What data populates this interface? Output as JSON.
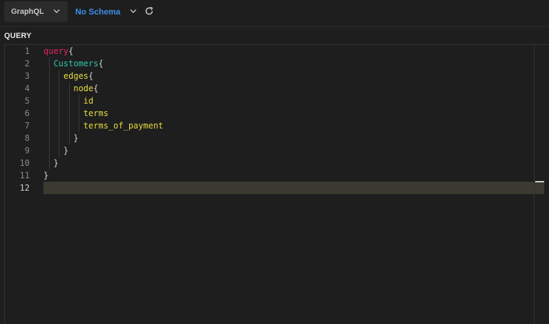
{
  "toolbar": {
    "language": "GraphQL",
    "schema": "No Schema",
    "refresh_icon": "refresh-icon",
    "chevron_icon": "chevron-down-icon"
  },
  "editor": {
    "section_label": "QUERY",
    "active_line": 12,
    "line_numbers": [
      "1",
      "2",
      "3",
      "4",
      "5",
      "6",
      "7",
      "8",
      "9",
      "10",
      "11",
      "12"
    ],
    "lines": [
      {
        "tokens": [
          {
            "text": "query",
            "cls": "kw"
          },
          {
            "text": "{",
            "cls": "brace"
          }
        ]
      },
      {
        "tokens": [
          {
            "text": "  "
          },
          {
            "text": "Customers",
            "cls": "type"
          },
          {
            "text": "{",
            "cls": "brace"
          }
        ]
      },
      {
        "tokens": [
          {
            "text": "    "
          },
          {
            "text": "edges",
            "cls": "field"
          },
          {
            "text": "{",
            "cls": "brace"
          }
        ]
      },
      {
        "tokens": [
          {
            "text": "      "
          },
          {
            "text": "node",
            "cls": "field"
          },
          {
            "text": "{",
            "cls": "brace"
          }
        ]
      },
      {
        "tokens": [
          {
            "text": "        "
          },
          {
            "text": "id",
            "cls": "field"
          }
        ]
      },
      {
        "tokens": [
          {
            "text": "        "
          },
          {
            "text": "terms",
            "cls": "field"
          }
        ]
      },
      {
        "tokens": [
          {
            "text": "        "
          },
          {
            "text": "terms_of_payment",
            "cls": "field"
          }
        ]
      },
      {
        "tokens": [
          {
            "text": "      "
          },
          {
            "text": "}",
            "cls": "brace"
          }
        ]
      },
      {
        "tokens": [
          {
            "text": "    "
          },
          {
            "text": "}",
            "cls": "brace"
          }
        ]
      },
      {
        "tokens": [
          {
            "text": "  "
          },
          {
            "text": "}",
            "cls": "brace"
          }
        ]
      },
      {
        "tokens": [
          {
            "text": "}",
            "cls": "brace"
          }
        ]
      },
      {
        "tokens": []
      }
    ]
  },
  "colors": {
    "keyword": "#e0275e",
    "type": "#2cc7a9",
    "field": "#e6db40",
    "schema_link": "#3d8eea",
    "active_line_bg": "#3b3a30"
  }
}
